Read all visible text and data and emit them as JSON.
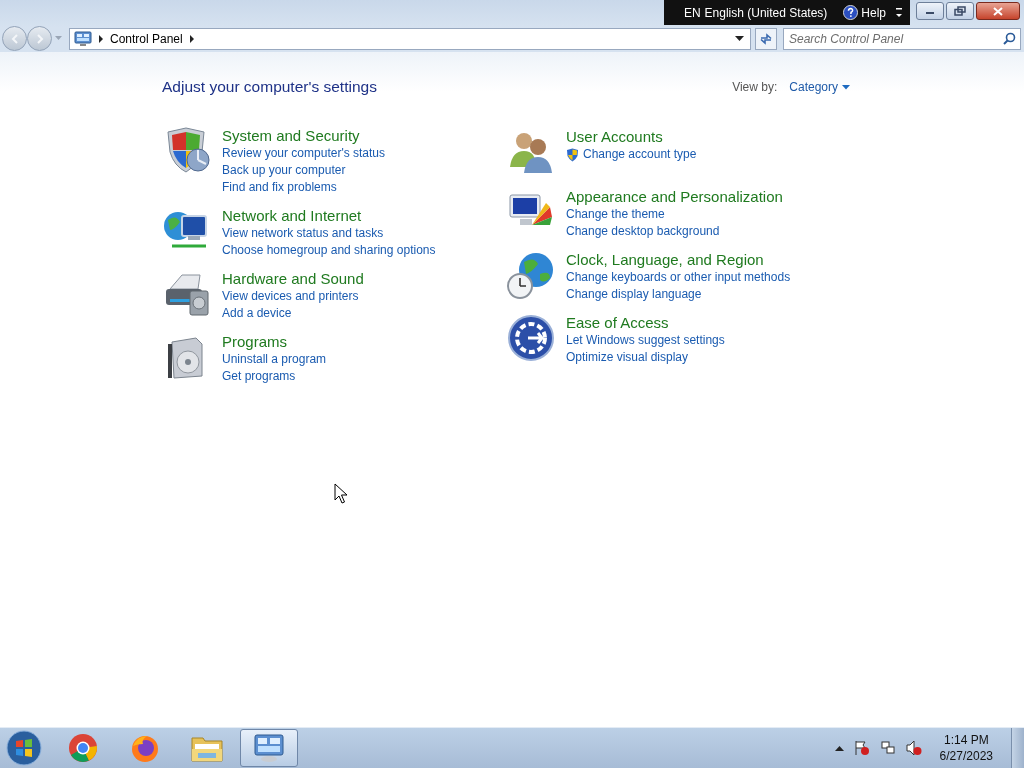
{
  "language_bar": {
    "code": "EN",
    "language": "English (United States)",
    "help": "Help"
  },
  "address_bar": {
    "crumbs": [
      "Control Panel"
    ]
  },
  "search": {
    "placeholder": "Search Control Panel"
  },
  "heading": "Adjust your computer's settings",
  "view_by": {
    "label": "View by:",
    "value": "Category"
  },
  "columns": [
    {
      "categories": [
        {
          "kind": "security",
          "title": "System and Security",
          "links": [
            {
              "text": "Review your computer's status",
              "kind": "plain"
            },
            {
              "text": "Back up your computer",
              "kind": "plain"
            },
            {
              "text": "Find and fix problems",
              "kind": "plain"
            }
          ]
        },
        {
          "kind": "network",
          "title": "Network and Internet",
          "links": [
            {
              "text": "View network status and tasks",
              "kind": "plain"
            },
            {
              "text": "Choose homegroup and sharing options",
              "kind": "plain"
            }
          ]
        },
        {
          "kind": "hardware",
          "title": "Hardware and Sound",
          "links": [
            {
              "text": "View devices and printers",
              "kind": "plain"
            },
            {
              "text": "Add a device",
              "kind": "plain"
            }
          ]
        },
        {
          "kind": "programs",
          "title": "Programs",
          "links": [
            {
              "text": "Uninstall a program",
              "kind": "plain"
            },
            {
              "text": "Get programs",
              "kind": "plain"
            }
          ]
        }
      ]
    },
    {
      "categories": [
        {
          "kind": "users",
          "title": "User Accounts",
          "links": [
            {
              "text": "Change account type",
              "kind": "admin"
            }
          ]
        },
        {
          "kind": "appearance",
          "title": "Appearance and Personalization",
          "links": [
            {
              "text": "Change the theme",
              "kind": "plain"
            },
            {
              "text": "Change desktop background",
              "kind": "plain"
            }
          ]
        },
        {
          "kind": "clock",
          "title": "Clock, Language, and Region",
          "links": [
            {
              "text": "Change keyboards or other input methods",
              "kind": "plain"
            },
            {
              "text": "Change display language",
              "kind": "plain"
            }
          ]
        },
        {
          "kind": "access",
          "title": "Ease of Access",
          "links": [
            {
              "text": "Let Windows suggest settings",
              "kind": "plain"
            },
            {
              "text": "Optimize visual display",
              "kind": "plain"
            }
          ]
        }
      ]
    }
  ],
  "taskbar": {
    "apps": [
      {
        "kind": "chrome",
        "selected": false
      },
      {
        "kind": "firefox",
        "selected": false
      },
      {
        "kind": "explorer",
        "selected": false
      },
      {
        "kind": "control",
        "selected": true
      }
    ],
    "time": "1:14 PM",
    "date": "6/27/2023"
  }
}
